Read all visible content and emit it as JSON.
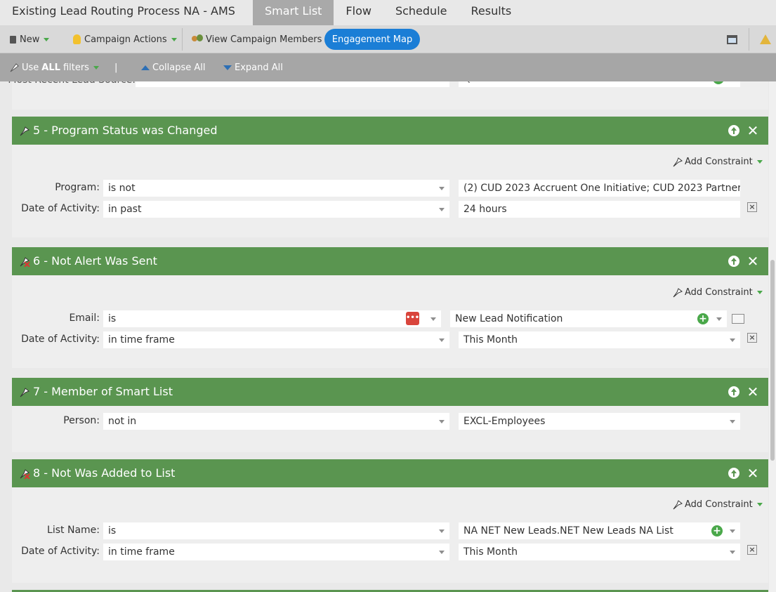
{
  "tabs": {
    "title": "Existing Lead Routing Process NA - AMS",
    "smart_list": "Smart List",
    "flow": "Flow",
    "schedule": "Schedule",
    "results": "Results"
  },
  "toolbar": {
    "new": "New",
    "campaign_actions": "Campaign Actions",
    "view_members": "View Campaign Members",
    "engagement_map": "Engagement Map"
  },
  "filter_toolbar": {
    "use": "Use",
    "all": "ALL",
    "filters": "filters",
    "divider": "|",
    "collapse": "Collapse All",
    "expand": "Expand All"
  },
  "partial_row": {
    "label": "Most Recent Lead Source:",
    "operator": "is not",
    "value": "Qualified Chat"
  },
  "filters": {
    "f5": {
      "title": "5 - Program Status was Changed",
      "add_constraint": "Add Constraint",
      "program_label": "Program:",
      "program_op": "is not",
      "program_value": "(2) CUD 2023 Accruent One Initiative; CUD 2023 Partner Requ",
      "date_label": "Date of Activity:",
      "date_op": "in past",
      "date_value": "24 hours"
    },
    "f6": {
      "title": "6 - Not Alert Was Sent",
      "add_constraint": "Add Constraint",
      "email_label": "Email:",
      "email_op": "is",
      "email_value": "New Lead Notification",
      "date_label": "Date of Activity:",
      "date_op": "in time frame",
      "date_value": "This Month"
    },
    "f7": {
      "title": "7 - Member of Smart List",
      "person_label": "Person:",
      "person_op": "not in",
      "person_value": "EXCL-Employees"
    },
    "f8": {
      "title": "8 - Not Was Added to List",
      "add_constraint": "Add Constraint",
      "list_label": "List Name:",
      "list_op": "is",
      "list_value": "NA NET New Leads.NET New Leads NA List",
      "date_label": "Date of Activity:",
      "date_op": "in time frame",
      "date_value": "This Month"
    }
  },
  "colors": {
    "header_green": "#5a9550",
    "pill_blue": "#1b7ed6",
    "active_tab": "#a9a9a9"
  }
}
